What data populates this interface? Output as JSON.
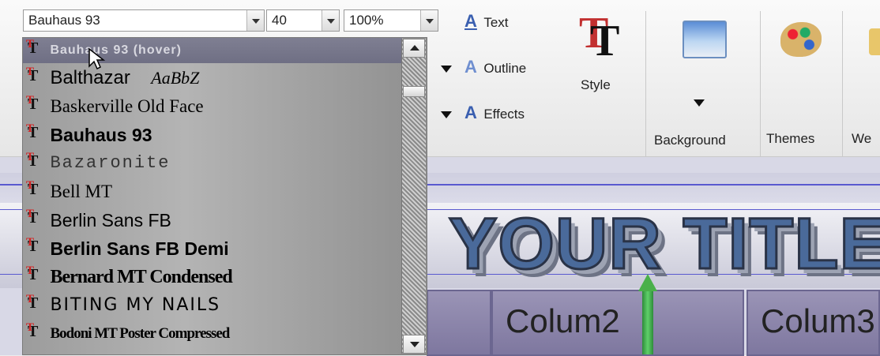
{
  "toolbar": {
    "font_value": "Bauhaus 93",
    "size_value": "40",
    "zoom_value": "100%"
  },
  "ribbon": {
    "text_label": "Text",
    "outline_label": "Outline",
    "effects_label": "Effects",
    "style_label": "Style",
    "background_label": "Background",
    "themes_label": "Themes",
    "web_label_partial": "We"
  },
  "font_list": {
    "items": [
      "Bauhaus 93 (hover)",
      "Balthazar",
      "Baskerville Old Face",
      "Bauhaus 93",
      "Bazaronite",
      "Bell MT",
      "Berlin Sans FB",
      "Berlin Sans FB Demi",
      "Bernard MT Condensed",
      "BITING MY NAILS",
      "Bodoni MT Poster Compressed"
    ],
    "balthazar_sample": "AaBbZ"
  },
  "canvas": {
    "title_text": "YOUR TITLE",
    "column2": "Colum2",
    "column3": "Colum3"
  },
  "colors": {
    "accent_blue": "#3a5fb0",
    "title_blue": "#4a6a9a",
    "cell_purple": "#8f89ad"
  }
}
